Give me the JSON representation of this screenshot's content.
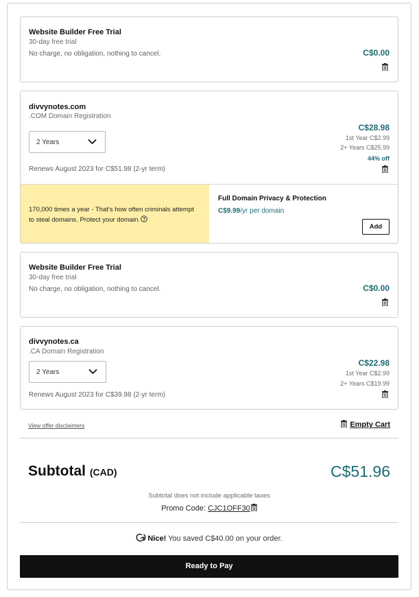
{
  "items": [
    {
      "title": "Website Builder Free Trial",
      "subtitle": "30-day free trial",
      "note": "No charge, no obligation, nothing to cancel.",
      "price": "C$0.00"
    },
    {
      "title": "divvynotes.com",
      "subtitle": ".COM Domain Registration",
      "term": "2 Years",
      "renewal": "Renews August 2023 for C$51.98 (2-yr term)",
      "price": "C$28.98",
      "first_year": "1st Year C$2.99",
      "later_years": "2+ Years C$25.99",
      "discount": "44% off"
    },
    {
      "title": "Website Builder Free Trial",
      "subtitle": "30-day free trial",
      "note": "No charge, no obligation, nothing to cancel.",
      "price": "C$0.00"
    },
    {
      "title": "divvynotes.ca",
      "subtitle": ".CA Domain Registration",
      "term": "2 Years",
      "renewal": "Renews August 2023 for C$39.98 (2-yr term)",
      "price": "C$22.98",
      "first_year": "1st Year C$2.99",
      "later_years": "2+ Years C$19.99"
    }
  ],
  "upsell": {
    "message": "170,000 times a year - That's how often criminals attempt to steal domains. Protect your domain.",
    "title": "Full Domain Privacy & Protection",
    "price": "C$9.99",
    "price_suffix": "/yr per domain",
    "add_label": "Add"
  },
  "links": {
    "disclaimers": "View offer disclaimers",
    "empty_cart": "Empty Cart"
  },
  "summary": {
    "subtotal_label": "Subtotal",
    "currency": "(CAD)",
    "subtotal_value": "C$51.96",
    "tax_note": "Subtotal does not include applicable taxes",
    "promo_label": "Promo Code:",
    "promo_code": "CJC1OFF30",
    "saved_prefix": "Nice!",
    "saved_text": "You saved C$40.00 on your order.",
    "pay_label": "Ready to Pay"
  },
  "colors": {
    "accent": "#1e6b73",
    "upsell_bg": "#feeea8",
    "pay_button_bg": "#111111"
  },
  "icons": [
    "trash-icon",
    "chevron-down-icon",
    "help-circle-icon",
    "godaddy-logo-icon"
  ]
}
